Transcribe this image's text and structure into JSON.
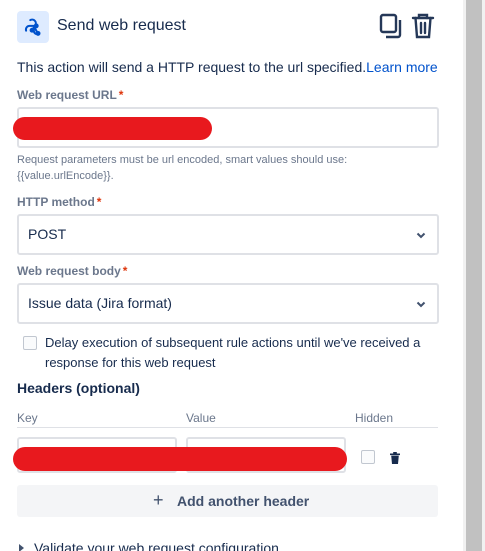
{
  "header": {
    "title": "Send web request",
    "action_icon": "webhook-icon",
    "copy_icon": "copy-icon",
    "delete_icon": "trash-icon"
  },
  "intro": {
    "text": "This action will send a HTTP request to the url specified.",
    "link": "Learn more"
  },
  "url_field": {
    "label": "Web request URL",
    "required_marker": "*",
    "value": "",
    "help": "Request parameters must be url encoded, smart values should use: {{value.urlEncode}}."
  },
  "method_field": {
    "label": "HTTP method",
    "required_marker": "*",
    "value": "POST"
  },
  "body_field": {
    "label": "Web request body",
    "required_marker": "*",
    "value": "Issue data (Jira format)"
  },
  "delay_checkbox": {
    "checked": false,
    "label": "Delay execution of subsequent rule actions until we've received a response for this web request"
  },
  "headers": {
    "title": "Headers (optional)",
    "columns": {
      "key": "Key",
      "value": "Value",
      "hidden": "Hidden"
    },
    "rows": [
      {
        "key": "",
        "value": "",
        "hidden": false
      }
    ],
    "add_label": "Add another header",
    "add_icon": "plus-icon"
  },
  "validate": {
    "label": "Validate your web request configuration",
    "icon": "chevron-right-icon"
  },
  "colors": {
    "link": "#0052cc",
    "required": "#de350b",
    "redaction": "#e8191e",
    "icon_bg": "#deebff"
  }
}
